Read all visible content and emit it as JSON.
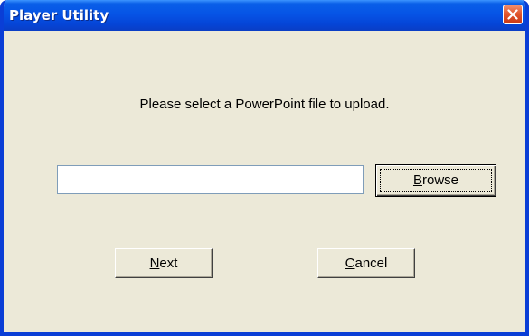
{
  "window": {
    "title": "Player Utility"
  },
  "dialog": {
    "prompt": "Please select a PowerPoint file to upload.",
    "file_path_value": "",
    "file_path_placeholder": ""
  },
  "buttons": {
    "browse": {
      "mnemonic": "B",
      "rest": "rowse"
    },
    "next": {
      "mnemonic": "N",
      "rest": "ext"
    },
    "cancel": {
      "mnemonic": "C",
      "rest": "ancel"
    }
  },
  "icons": {
    "close": "close-icon"
  },
  "colors": {
    "titlebar": "#0654e6",
    "window_face": "#ece9d8",
    "close_button": "#e2572e"
  }
}
